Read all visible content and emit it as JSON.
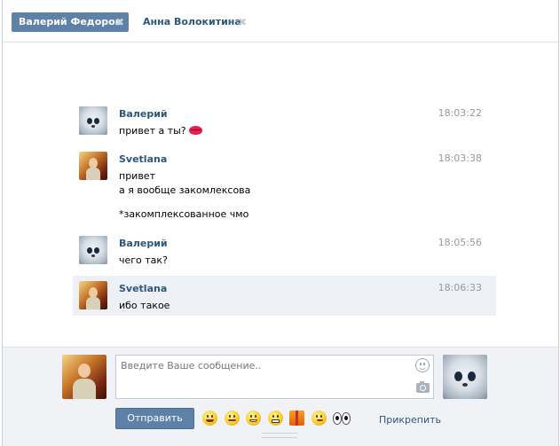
{
  "tabs": [
    {
      "label": "Валерий Федоров",
      "active": true
    },
    {
      "label": "Анна Волокитина",
      "active": false
    }
  ],
  "tab_close_glyph": "✖",
  "messages": [
    {
      "sender": "Валерий",
      "time": "18:03:22",
      "lines": [
        "привет а ты?"
      ],
      "avatar": "cat-avatar",
      "emoji": "kiss-icon"
    },
    {
      "sender": "Svetlana",
      "time": "18:03:38",
      "lines": [
        "привет",
        "а я вообще закомлексова",
        "*закомплексованное чмо"
      ],
      "avatar": "girl-avatar"
    },
    {
      "sender": "Валерий",
      "time": "18:05:56",
      "lines": [
        "чего так?"
      ],
      "avatar": "cat-avatar"
    },
    {
      "sender": "Svetlana",
      "time": "18:06:33",
      "lines": [
        "ибо такое"
      ],
      "avatar": "girl-avatar",
      "highlighted": true
    }
  ],
  "composer": {
    "placeholder": "Введите Ваше сообщение..",
    "send_label": "Отправить",
    "attach_label": "Прикрепить",
    "emoji_icons": [
      "laugh-emoji-icon",
      "blush-emoji-icon",
      "grin-emoji-icon",
      "angry-emoji-icon",
      "gift-emoji-icon",
      "smirk-emoji-icon",
      "eyes-emoji-icon"
    ]
  },
  "colors": {
    "accent": "#5e81a8",
    "link": "#2b587a",
    "highlight_bg": "#edf1f5",
    "composer_bg": "#f0f2f5",
    "time": "#999999"
  }
}
